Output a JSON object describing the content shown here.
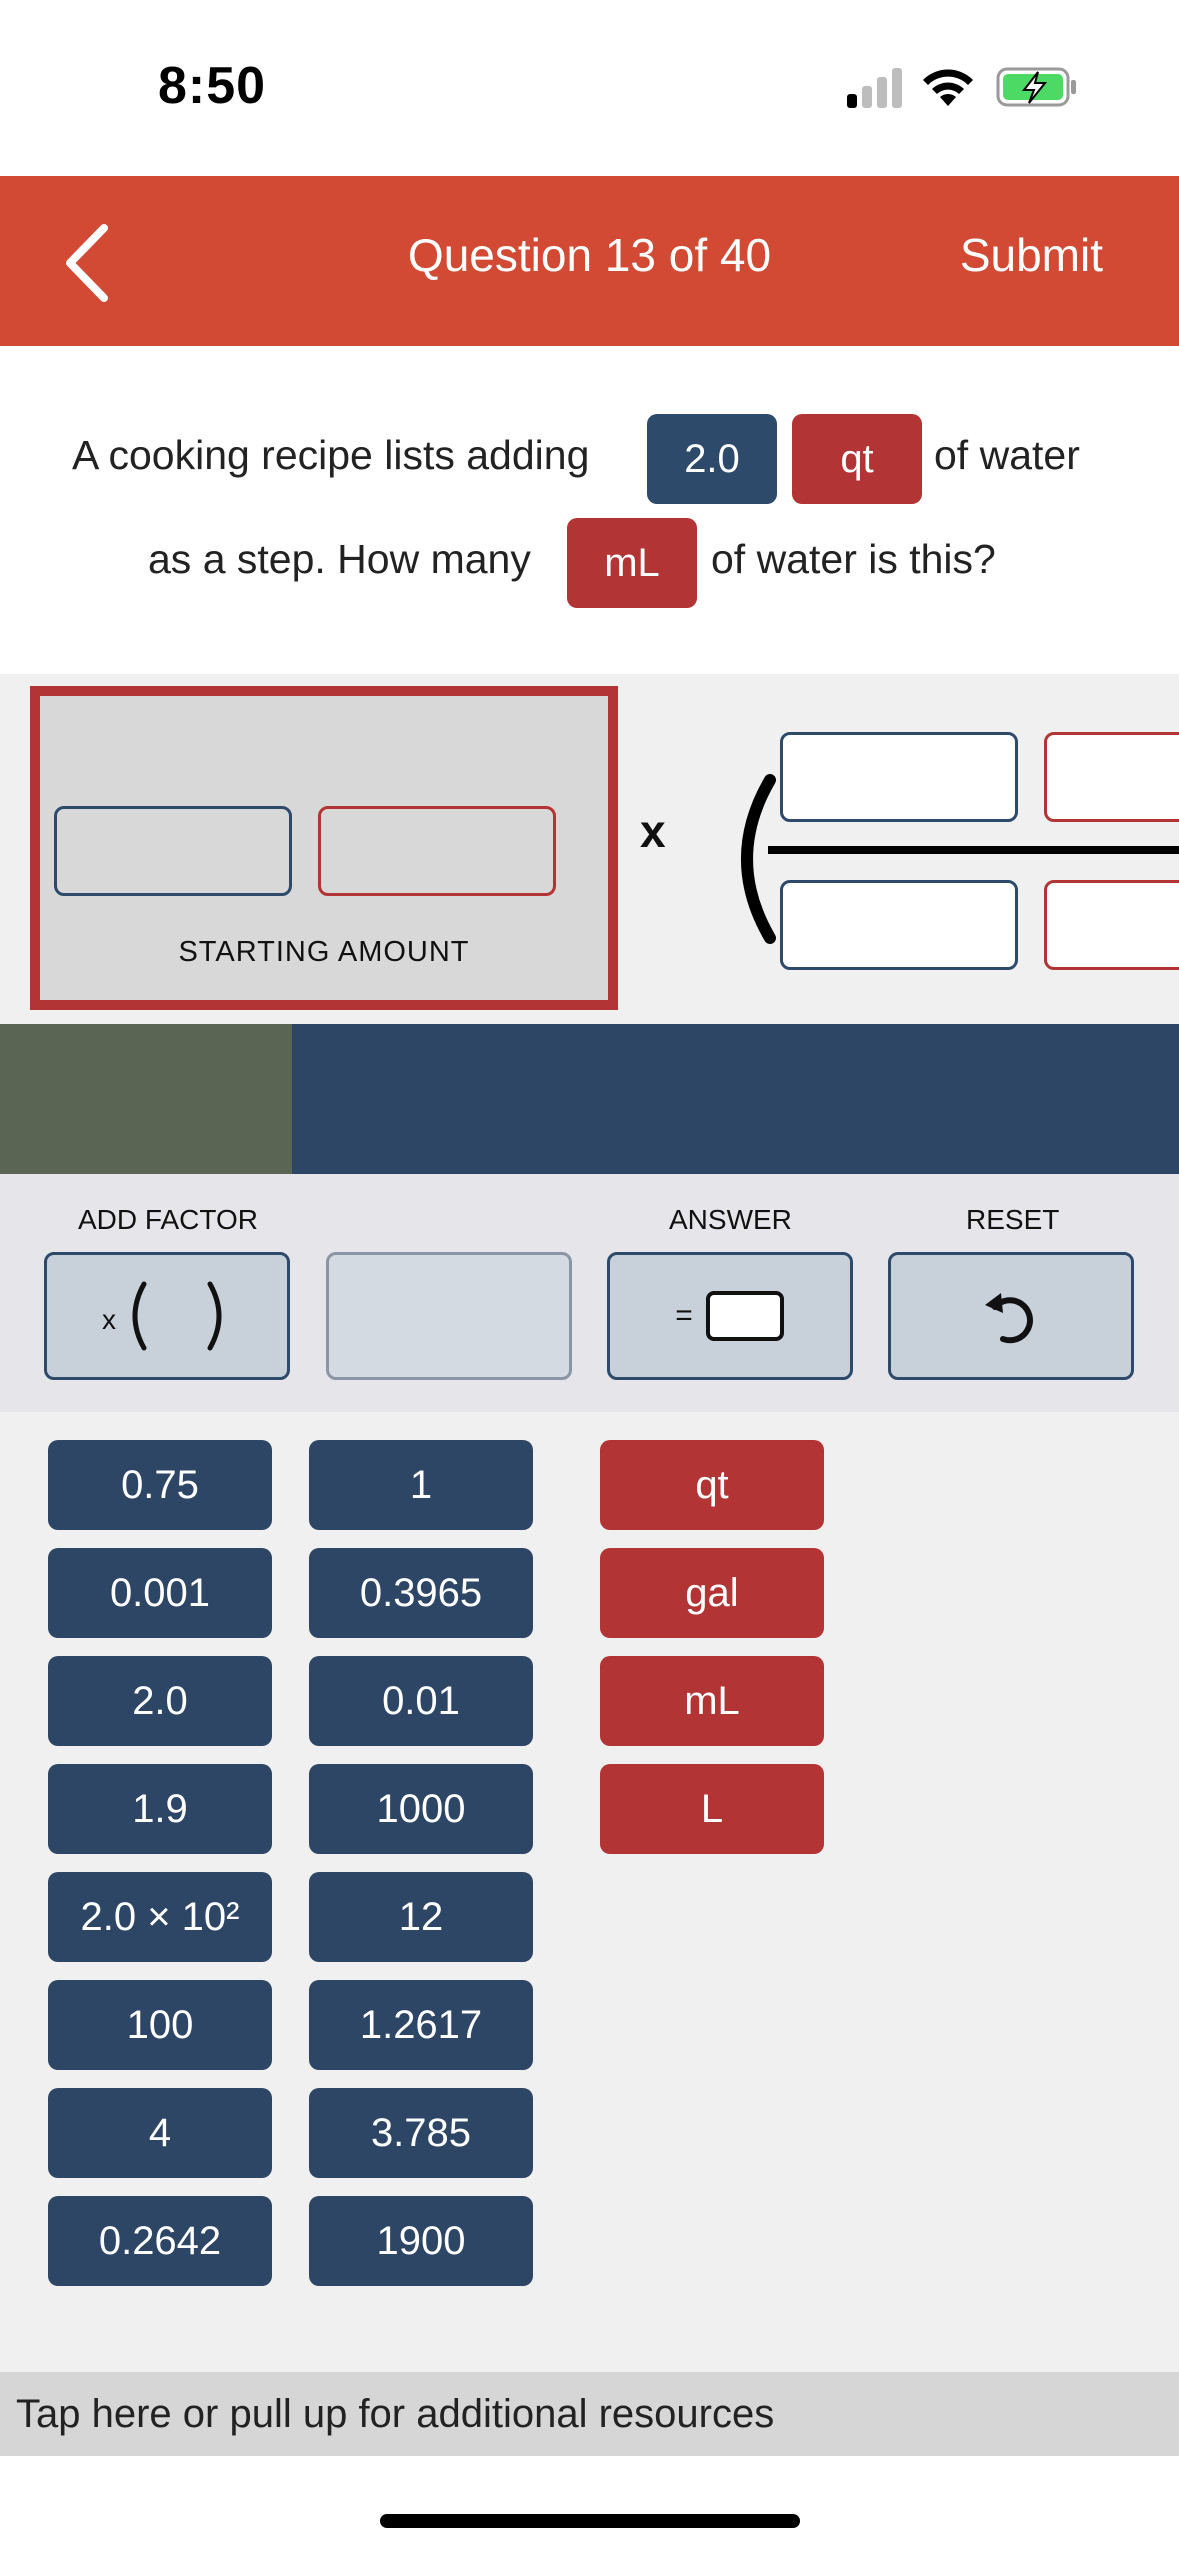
{
  "status_bar": {
    "time": "8:50"
  },
  "header": {
    "title": "Question 13 of 40",
    "submit_label": "Submit"
  },
  "question": {
    "line1_text": "A cooking recipe lists adding",
    "given_value": "2.0",
    "given_unit": "qt",
    "line1_end": "of water",
    "line2_text": "as a step. How many",
    "target_unit": "mL",
    "line2_end": "of water is this?"
  },
  "workspace": {
    "starting_amount_label": "STARTING AMOUNT",
    "times_symbol": "x"
  },
  "controls": {
    "add_factor_label": "ADD FACTOR",
    "add_factor_symbol": "x",
    "answer_label": "ANSWER",
    "answer_symbol": "=",
    "reset_label": "RESET"
  },
  "number_tiles_col1": [
    "0.75",
    "0.001",
    "2.0",
    "1.9",
    "2.0 × 10²",
    "100",
    "4",
    "0.2642"
  ],
  "number_tiles_col2": [
    "1",
    "0.3965",
    "0.01",
    "1000",
    "12",
    "1.2617",
    "3.785",
    "1900"
  ],
  "unit_tiles": [
    "qt",
    "gal",
    "mL",
    "L"
  ],
  "resources": {
    "text": "Tap here or pull up for additional resources"
  },
  "colors": {
    "header": "#d24a33",
    "navy": "#2d4665",
    "unit_red": "#b33434",
    "olive": "#5b6554"
  }
}
